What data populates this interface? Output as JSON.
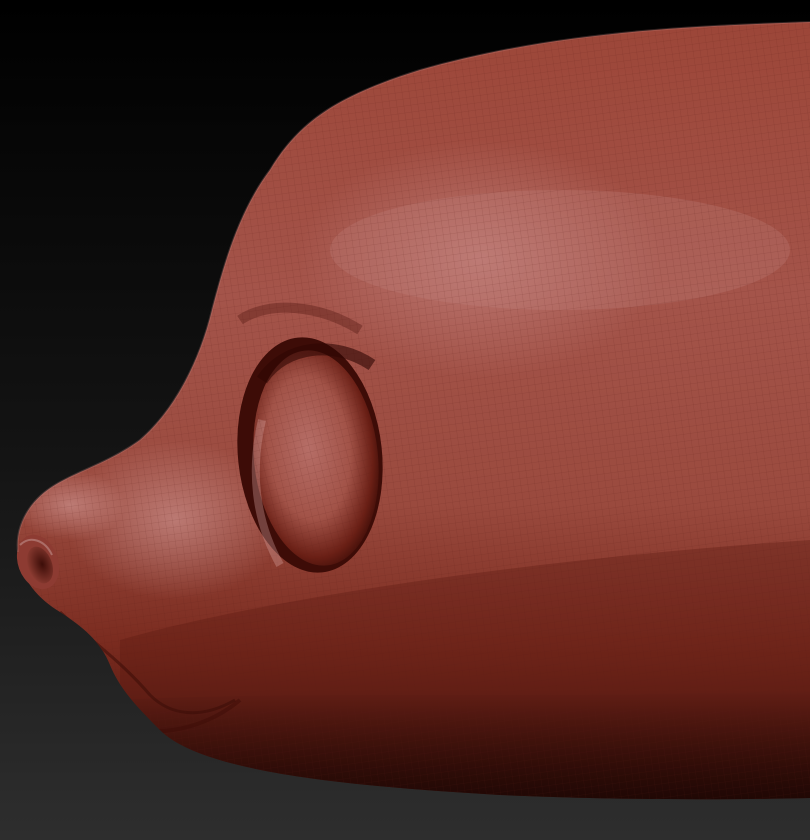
{
  "scene": {
    "subject": "sculpted-animal-head-side-profile",
    "material": "red-wax-clay",
    "wireframe_overlay": true
  },
  "colors": {
    "background_top": "#000000",
    "background_mid": "#141414",
    "background_bottom": "#2e2e2e",
    "clay_base": "#8f3a2e",
    "clay_light": "#b06a63",
    "clay_highlight": "#c88a85",
    "clay_shadow": "#4a120c",
    "clay_deep_shadow": "#2a0704",
    "wire_line": "#5a1c14"
  }
}
